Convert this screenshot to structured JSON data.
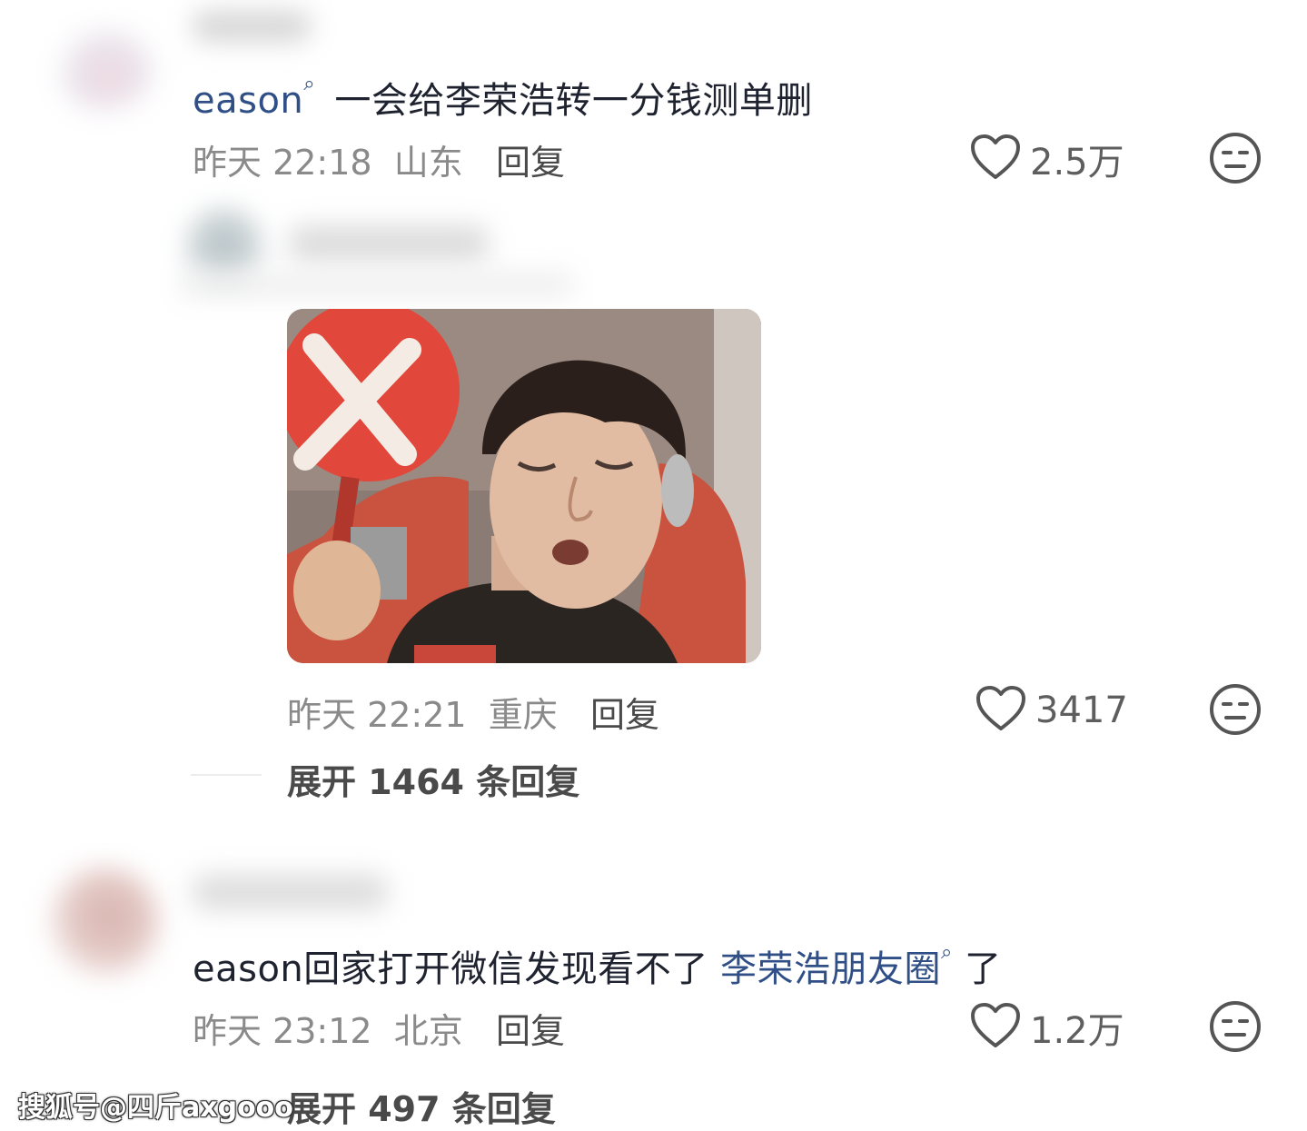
{
  "comments": [
    {
      "username": "eason",
      "text": "一会给李荣浩转一分钱测单删",
      "time": "昨天 22:18",
      "location": "山东",
      "reply_label": "回复",
      "likes": "2.5万"
    },
    {
      "time": "昨天 22:21",
      "location": "重庆",
      "reply_label": "回复",
      "likes": "3417",
      "expand_label": "展开 1464 条回复"
    },
    {
      "text_prefix": "eason回家打开微信发现看不了 ",
      "text_link": "李荣浩朋友圈",
      "text_suffix": " 了",
      "time": "昨天 23:12",
      "location": "北京",
      "reply_label": "回复",
      "likes": "1.2万",
      "expand_label": "展开 497 条回复"
    }
  ],
  "watermark": "搜狐号@四斤axgooo",
  "colors": {
    "link": "#2f4f86",
    "meta": "#8a8a8a",
    "sticker_sign": "#e2473b"
  }
}
